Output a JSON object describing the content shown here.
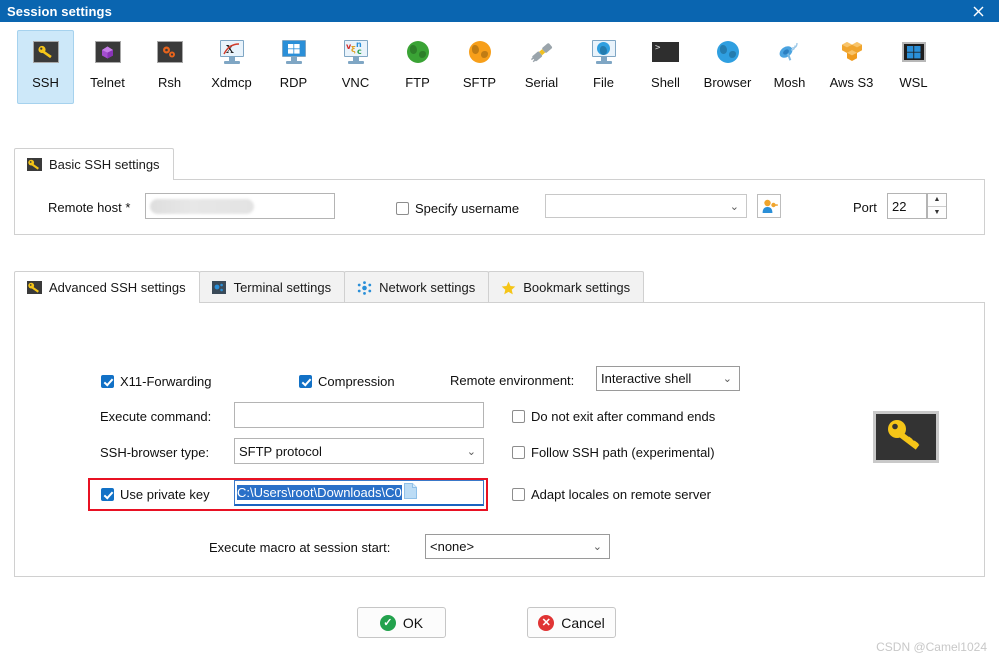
{
  "window": {
    "title": "Session settings",
    "close_icon": "close-icon",
    "accent_color": "#0a65b0"
  },
  "protocols": {
    "selected": "SSH",
    "items": [
      {
        "label": "SSH",
        "icon": "key-icon"
      },
      {
        "label": "Telnet",
        "icon": "telnet-gem-icon"
      },
      {
        "label": "Rsh",
        "icon": "gears-icon"
      },
      {
        "label": "Xdmcp",
        "icon": "x-monitor-icon"
      },
      {
        "label": "RDP",
        "icon": "windows-monitor-icon"
      },
      {
        "label": "VNC",
        "icon": "vnc-monitor-icon"
      },
      {
        "label": "FTP",
        "icon": "green-globe-icon"
      },
      {
        "label": "SFTP",
        "icon": "orange-globe-icon"
      },
      {
        "label": "Serial",
        "icon": "serial-plug-icon"
      },
      {
        "label": "File",
        "icon": "file-monitor-icon"
      },
      {
        "label": "Shell",
        "icon": "terminal-icon"
      },
      {
        "label": "Browser",
        "icon": "blue-globe-icon"
      },
      {
        "label": "Mosh",
        "icon": "satellite-icon"
      },
      {
        "label": "Aws S3",
        "icon": "aws-cubes-icon"
      },
      {
        "label": "WSL",
        "icon": "windows-icon"
      }
    ]
  },
  "basic": {
    "tab_label": "Basic SSH settings",
    "tab_icon": "key-icon",
    "remote_host_label": "Remote host *",
    "remote_host_value": "",
    "specify_username_label": "Specify username",
    "specify_username_checked": false,
    "username_value": "",
    "user_picker_icon": "user-key-icon",
    "port_label": "Port",
    "port_value": "22"
  },
  "advanced": {
    "tabs": [
      {
        "label": "Advanced SSH settings",
        "icon": "key-icon",
        "active": true
      },
      {
        "label": "Terminal settings",
        "icon": "terminal-settings-icon",
        "active": false
      },
      {
        "label": "Network settings",
        "icon": "network-nodes-icon",
        "active": false
      },
      {
        "label": "Bookmark settings",
        "icon": "star-icon",
        "active": false
      }
    ],
    "x11_label": "X11-Forwarding",
    "x11_checked": true,
    "compression_label": "Compression",
    "compression_checked": true,
    "remote_env_label": "Remote environment:",
    "remote_env_value": "Interactive shell",
    "execute_command_label": "Execute command:",
    "execute_command_value": "",
    "do_not_exit_label": "Do not exit after command ends",
    "do_not_exit_checked": false,
    "ssh_browser_label": "SSH-browser type:",
    "ssh_browser_value": "SFTP protocol",
    "follow_ssh_path_label": "Follow SSH path (experimental)",
    "follow_ssh_path_checked": false,
    "use_private_key_label": "Use private key",
    "use_private_key_checked": true,
    "private_key_value": "C:\\Users\\root\\Downloads\\C0",
    "private_key_file_icon": "file-icon",
    "adapt_locales_label": "Adapt locales on remote server",
    "adapt_locales_checked": false,
    "execute_macro_label": "Execute macro at session start:",
    "execute_macro_value": "<none>",
    "key_picture_icon": "key-icon",
    "highlight_color": "#e81123"
  },
  "footer": {
    "ok_label": "OK",
    "ok_icon": "check-circle-icon",
    "cancel_label": "Cancel",
    "cancel_icon": "x-circle-icon"
  },
  "watermark": "CSDN @Camel1024"
}
